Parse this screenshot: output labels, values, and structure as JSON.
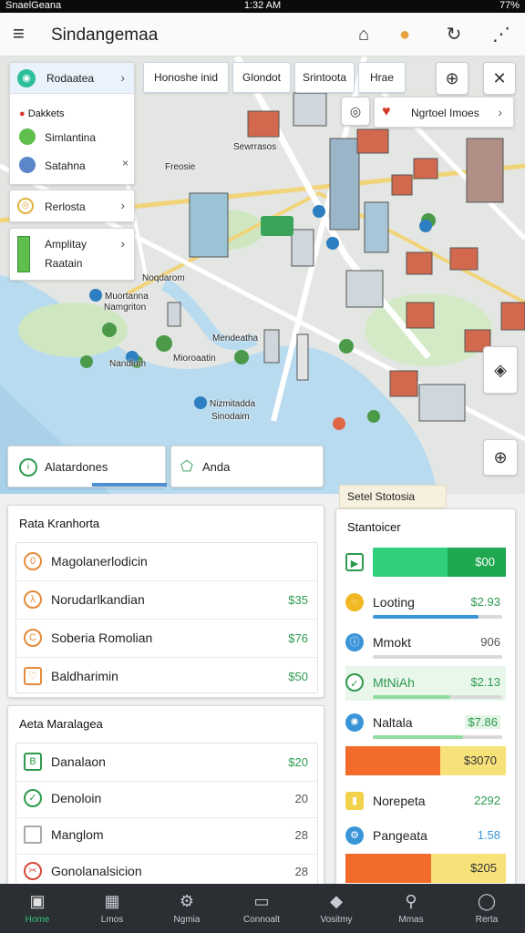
{
  "status_bar": {
    "carrier": "SnaelGeana",
    "time": "1:32 AM",
    "battery": "77%"
  },
  "app_bar": {
    "title": "Sindangemaa",
    "icons": [
      "menu-icon",
      "home-icon",
      "location-pin-icon",
      "refresh-icon",
      "more-icon"
    ]
  },
  "map": {
    "layer_panel": {
      "header": "Rodaatea",
      "section_label": "Dakkets",
      "items": [
        "Simlantina",
        "Satahna"
      ]
    },
    "card_reference": {
      "label": "Rerlosta"
    },
    "card_amplify": {
      "line1": "Amplitay",
      "line2": "Raatain"
    },
    "chips": [
      "Honoshe inid",
      "Glondot",
      "Srintoota",
      "Hrae"
    ],
    "nearby_chip": "Ngrtoel Imoes",
    "labels": [
      "Sewrrasos",
      "Freosie",
      "Noqdarom",
      "Mendeatha",
      "Muortanna",
      "Nizmitadda",
      "Nandlum",
      "Mioroaatin",
      "Namgriton",
      "Sinodaim"
    ],
    "tab_alerts": "Alatardones",
    "tab_area": "Anda"
  },
  "panel_left_top": {
    "title": "Rata Kranhorta",
    "items": [
      {
        "label": "Magolanerlodicin",
        "value": ""
      },
      {
        "label": "Norudarlkandian",
        "value": "$35"
      },
      {
        "label": "Soberia Romolian",
        "value": "$76"
      },
      {
        "label": "Baldharimin",
        "value": "$50"
      }
    ]
  },
  "panel_left_bottom": {
    "title": "Aeta Maralagea",
    "items": [
      {
        "label": "Danalaon",
        "value": "$20"
      },
      {
        "label": "Denoloin",
        "value": "20"
      },
      {
        "label": "Manglom",
        "value": "28"
      },
      {
        "label": "Gonolanalsicion",
        "value": "28"
      }
    ]
  },
  "panel_right": {
    "tab": "Setel Stotosia",
    "title": "Stantoicer",
    "rows": [
      {
        "label": "",
        "value": "$00",
        "level": 1.0,
        "color": "#2fcf7d"
      },
      {
        "label": "Looting",
        "value": "$2.93",
        "level": 0.82,
        "color": "#3a95d8"
      },
      {
        "label": "Mmokt",
        "value": "906",
        "level": 0.0,
        "color": "#c8c8c8"
      },
      {
        "label": "MtNiAh",
        "value": "$2.13",
        "level": 0.6,
        "color": "#8fdd9f"
      },
      {
        "label": "Naltala",
        "value": "$7.86",
        "level": 0.7,
        "color": "#8fdd9f"
      },
      {
        "label": "",
        "value": "$3070",
        "level": 0.6,
        "color": "#f26b2a"
      },
      {
        "label": "Norepeta",
        "value": "2292",
        "level": 0.0,
        "color": "#ffffff"
      },
      {
        "label": "Pangeata",
        "value": "1.58",
        "level": 0.0,
        "color": "#ffffff"
      },
      {
        "label": "",
        "value": "$205",
        "level": 0.55,
        "color": "#f26b2a"
      }
    ]
  },
  "bottom_nav": {
    "items": [
      {
        "label": "Home",
        "icon": "home-icon"
      },
      {
        "label": "Lmos",
        "icon": "building-icon"
      },
      {
        "label": "Ngmia",
        "icon": "gear-icon"
      },
      {
        "label": "Connoalt",
        "icon": "chat-icon"
      },
      {
        "label": "Vositmy",
        "icon": "bell-icon"
      },
      {
        "label": "Mmas",
        "icon": "search-icon"
      },
      {
        "label": "Rerta",
        "icon": "help-icon"
      }
    ]
  }
}
